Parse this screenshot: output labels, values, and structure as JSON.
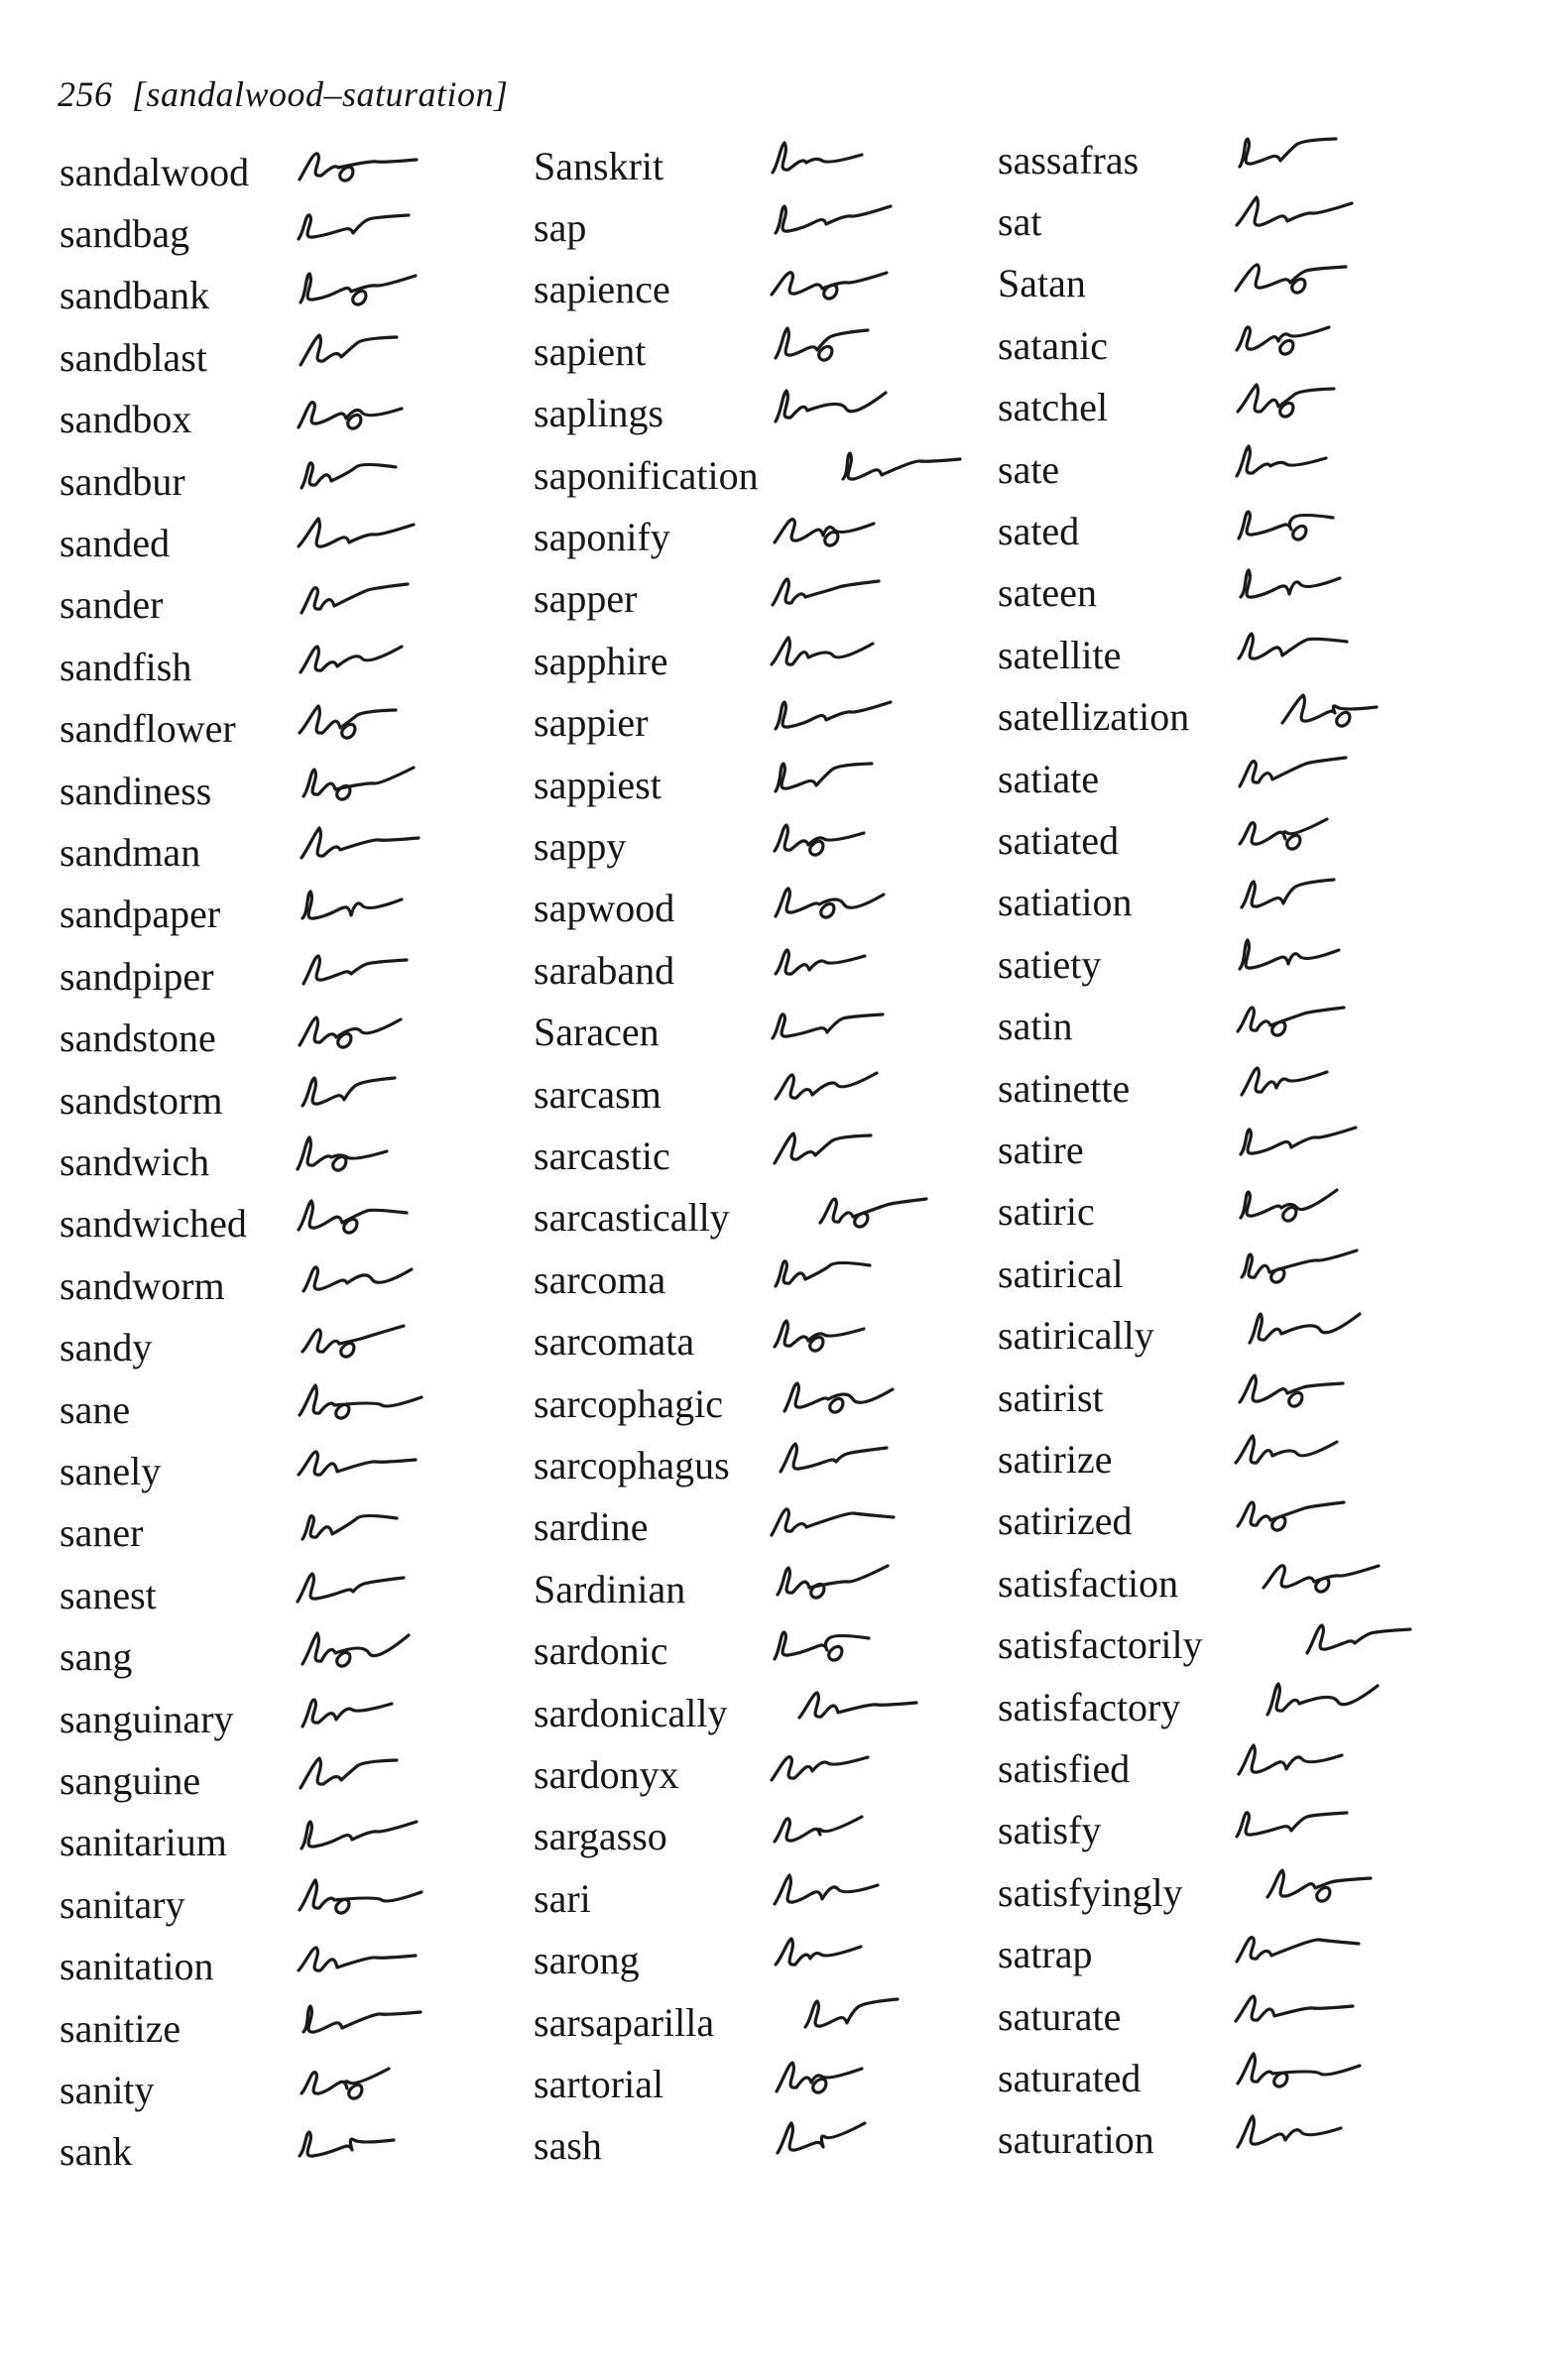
{
  "header": {
    "page_number": "256",
    "range": "[sandalwood–saturation]"
  },
  "columns": [
    {
      "entries": [
        {
          "word": "sandalwood"
        },
        {
          "word": "sandbag"
        },
        {
          "word": "sandbank"
        },
        {
          "word": "sandblast"
        },
        {
          "word": "sandbox"
        },
        {
          "word": "sandbur"
        },
        {
          "word": "sanded"
        },
        {
          "word": "sander"
        },
        {
          "word": "sandfish"
        },
        {
          "word": "sandflower"
        },
        {
          "word": "sandiness"
        },
        {
          "word": "sandman"
        },
        {
          "word": "sandpaper"
        },
        {
          "word": "sandpiper"
        },
        {
          "word": "sandstone"
        },
        {
          "word": "sandstorm"
        },
        {
          "word": "sandwich"
        },
        {
          "word": "sandwiched"
        },
        {
          "word": "sandworm"
        },
        {
          "word": "sandy"
        },
        {
          "word": "sane"
        },
        {
          "word": "sanely"
        },
        {
          "word": "saner"
        },
        {
          "word": "sanest"
        },
        {
          "word": "sang"
        },
        {
          "word": "sanguinary"
        },
        {
          "word": "sanguine"
        },
        {
          "word": "sanitarium"
        },
        {
          "word": "sanitary"
        },
        {
          "word": "sanitation"
        },
        {
          "word": "sanitize"
        },
        {
          "word": "sanity"
        },
        {
          "word": "sank"
        }
      ]
    },
    {
      "entries": [
        {
          "word": "Sanskrit"
        },
        {
          "word": "sap"
        },
        {
          "word": "sapience"
        },
        {
          "word": "sapient"
        },
        {
          "word": "saplings"
        },
        {
          "word": "saponification"
        },
        {
          "word": "saponify"
        },
        {
          "word": "sapper"
        },
        {
          "word": "sapphire"
        },
        {
          "word": "sappier"
        },
        {
          "word": "sappiest"
        },
        {
          "word": "sappy"
        },
        {
          "word": "sapwood"
        },
        {
          "word": "saraband"
        },
        {
          "word": "Saracen"
        },
        {
          "word": "sarcasm"
        },
        {
          "word": "sarcastic"
        },
        {
          "word": "sarcastically"
        },
        {
          "word": "sarcoma"
        },
        {
          "word": "sarcomata"
        },
        {
          "word": "sarcophagic"
        },
        {
          "word": "sarcophagus"
        },
        {
          "word": "sardine"
        },
        {
          "word": "Sardinian"
        },
        {
          "word": "sardonic"
        },
        {
          "word": "sardonically"
        },
        {
          "word": "sardonyx"
        },
        {
          "word": "sargasso"
        },
        {
          "word": "sari"
        },
        {
          "word": "sarong"
        },
        {
          "word": "sarsaparilla"
        },
        {
          "word": "sartorial"
        },
        {
          "word": "sash"
        }
      ]
    },
    {
      "entries": [
        {
          "word": "sassafras"
        },
        {
          "word": "sat"
        },
        {
          "word": "Satan"
        },
        {
          "word": "satanic"
        },
        {
          "word": "satchel"
        },
        {
          "word": "sate"
        },
        {
          "word": "sated"
        },
        {
          "word": "sateen"
        },
        {
          "word": "satellite"
        },
        {
          "word": "satellization"
        },
        {
          "word": "satiate"
        },
        {
          "word": "satiated"
        },
        {
          "word": "satiation"
        },
        {
          "word": "satiety"
        },
        {
          "word": "satin"
        },
        {
          "word": "satinette"
        },
        {
          "word": "satire"
        },
        {
          "word": "satiric"
        },
        {
          "word": "satirical"
        },
        {
          "word": "satirically"
        },
        {
          "word": "satirist"
        },
        {
          "word": "satirize"
        },
        {
          "word": "satirized"
        },
        {
          "word": "satisfaction"
        },
        {
          "word": "satisfactorily"
        },
        {
          "word": "satisfactory"
        },
        {
          "word": "satisfied"
        },
        {
          "word": "satisfy"
        },
        {
          "word": "satisfyingly"
        },
        {
          "word": "satrap"
        },
        {
          "word": "saturate"
        },
        {
          "word": "saturated"
        },
        {
          "word": "saturation"
        }
      ]
    }
  ]
}
